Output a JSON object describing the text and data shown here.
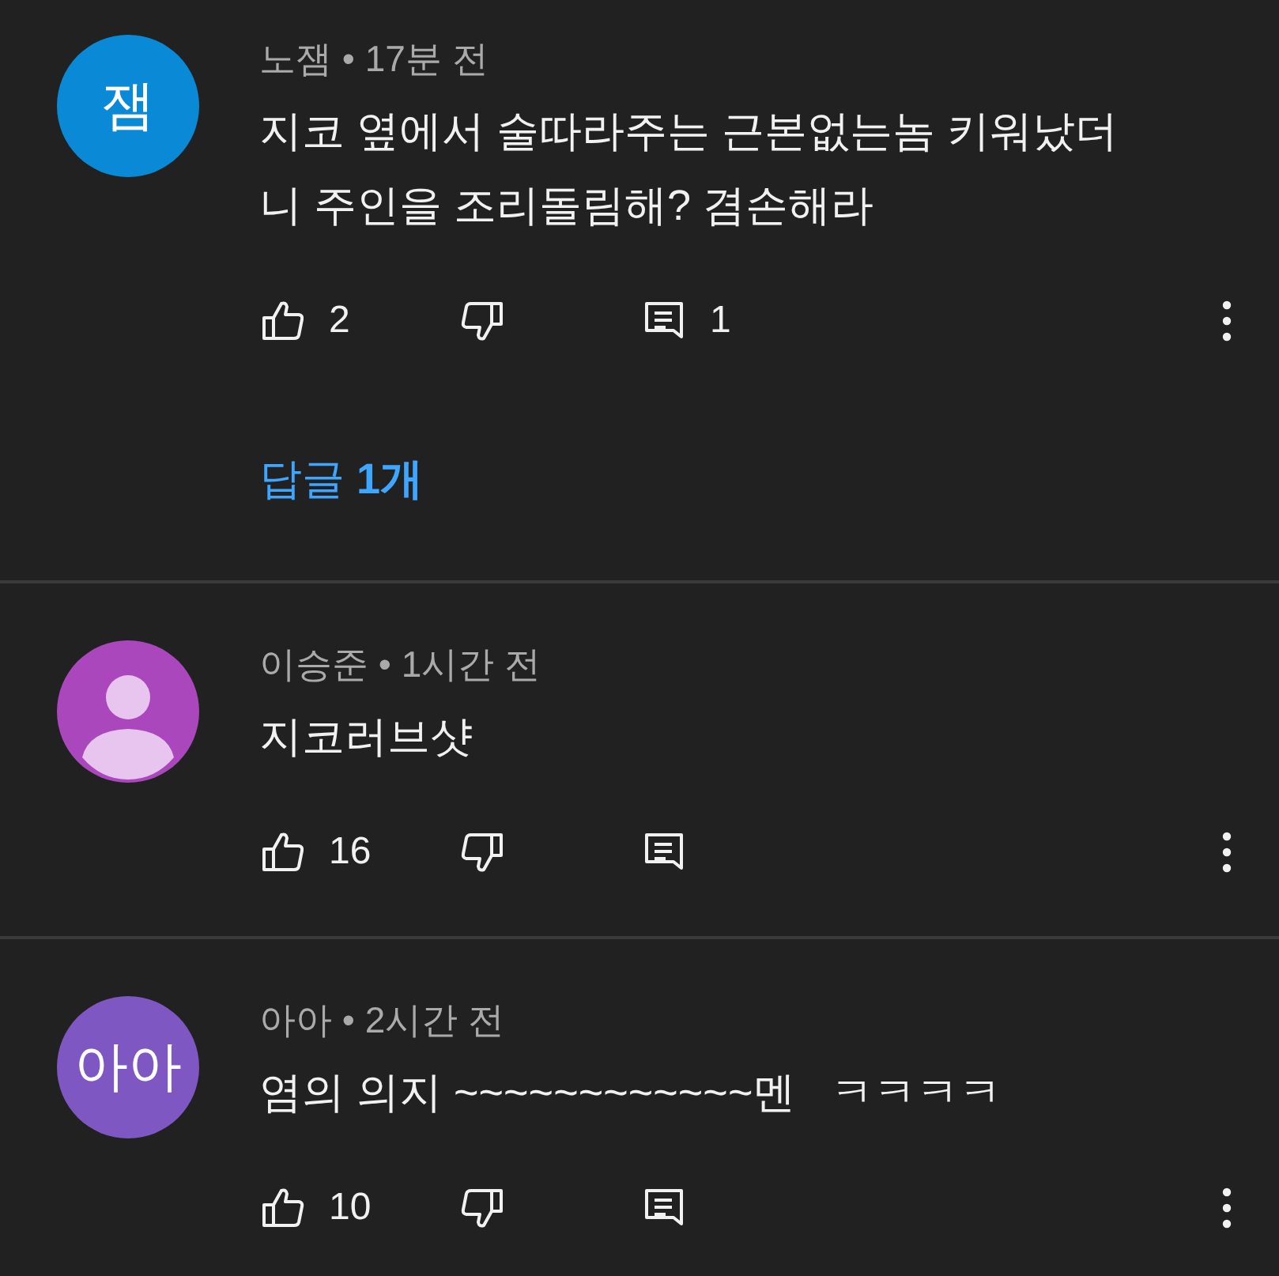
{
  "comments": [
    {
      "avatar": {
        "kind": "letter",
        "text": "잼",
        "color": "#0a8ad6"
      },
      "meta": "노잼 • 17분 전",
      "text": "지코 옆에서 술따라주는 근본없는놈 키워났더니 주인을 조리돌림해? 겸손해라",
      "likes": "2",
      "reply_count": "1",
      "replies_link": "답글 **1개**"
    },
    {
      "avatar": {
        "kind": "silhouette",
        "color": "#ab47bc"
      },
      "meta": "이승준 • 1시간 전",
      "text": "지코러브샷",
      "likes": "16"
    },
    {
      "avatar": {
        "kind": "letter",
        "text": "아아",
        "color": "#7e57c2"
      },
      "meta": "아아 • 2시간 전",
      "text": "염의 의지 ~~~~~~~~~~~~멘   ㅋㅋㅋㅋ",
      "likes": "10"
    }
  ]
}
